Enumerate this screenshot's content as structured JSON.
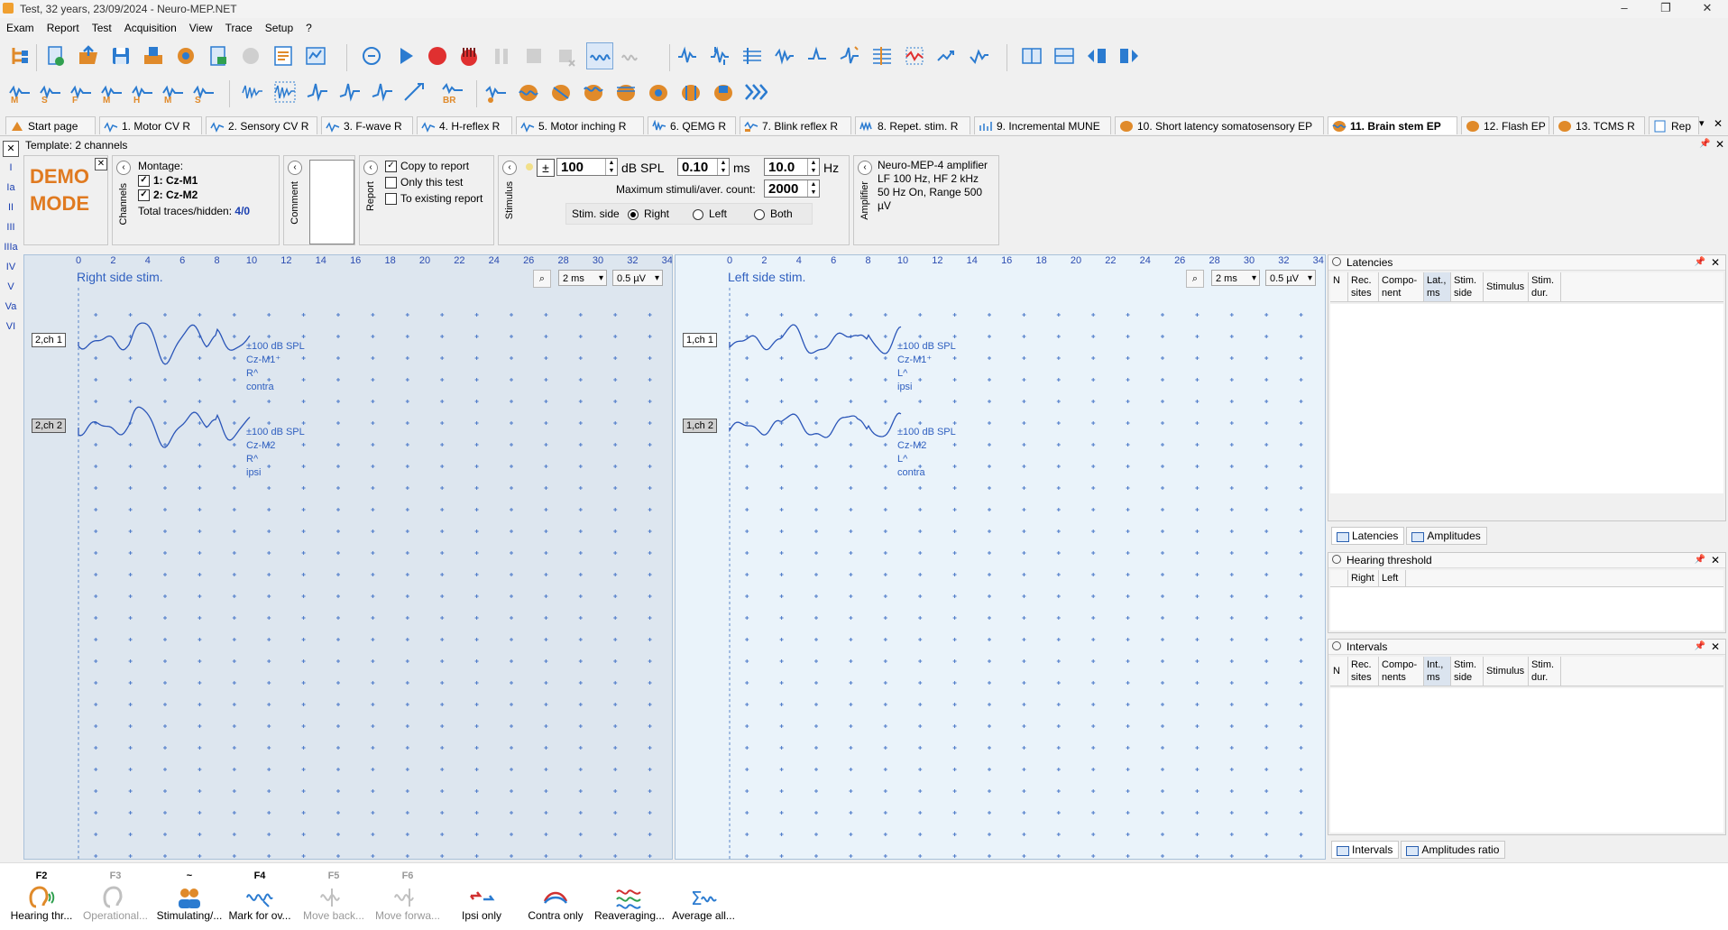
{
  "window": {
    "title": "Test, 32 years, 23/09/2024 - Neuro-MEP.NET",
    "min": "–",
    "max": "❐",
    "close": "✕"
  },
  "menu": [
    "Exam",
    "Report",
    "Test",
    "Acquisition",
    "View",
    "Trace",
    "Setup",
    "?"
  ],
  "tabs": [
    {
      "label": "Start page",
      "active": false
    },
    {
      "label": "1. Motor CV R",
      "active": false
    },
    {
      "label": "2. Sensory CV R",
      "active": false
    },
    {
      "label": "3. F-wave R",
      "active": false
    },
    {
      "label": "4. H-reflex R",
      "active": false
    },
    {
      "label": "5. Motor inching R",
      "active": false
    },
    {
      "label": "6. QEMG R",
      "active": false
    },
    {
      "label": "7. Blink reflex R",
      "active": false
    },
    {
      "label": "8. Repet. stim. R",
      "active": false
    },
    {
      "label": "9. Incremental MUNE",
      "active": false
    },
    {
      "label": "10. Short latency somatosensory EP",
      "active": false
    },
    {
      "label": "11. Brain stem EP",
      "active": true
    },
    {
      "label": "12. Flash EP",
      "active": false
    },
    {
      "label": "13. TCMS R",
      "active": false
    },
    {
      "label": "Rep",
      "active": false
    }
  ],
  "rail": [
    "I",
    "Ia",
    "II",
    "III",
    "IIIa",
    "IV",
    "V",
    "Va",
    "VI"
  ],
  "template": {
    "title": "Template: 2 channels"
  },
  "demo": {
    "line1": "DEMO",
    "line2": "MODE"
  },
  "channels": {
    "vlabel": "Channels",
    "montage_label": "Montage:",
    "items": [
      "1: Cz-M1",
      "2: Cz-M2"
    ],
    "total_label": "Total traces/hidden:",
    "total_value": "4/0"
  },
  "comment": {
    "vlabel": "Comment"
  },
  "report": {
    "vlabel": "Report",
    "options": [
      {
        "label": "Copy to report",
        "checked": true
      },
      {
        "label": "Only this test",
        "checked": false
      },
      {
        "label": "To existing report",
        "checked": false
      }
    ]
  },
  "stimulus": {
    "vlabel": "Stimulus",
    "intensity": "100",
    "intensity_unit": "dB SPL",
    "duration": "0.10",
    "duration_unit": "ms",
    "rate": "10.0",
    "rate_unit": "Hz",
    "max_label": "Maximum stimuli/aver. count:",
    "max_value": "2000",
    "side_label": "Stim. side",
    "sides": [
      {
        "label": "Right",
        "selected": true
      },
      {
        "label": "Left",
        "selected": false
      },
      {
        "label": "Both",
        "selected": false
      }
    ]
  },
  "amplifier": {
    "vlabel": "Amplifier",
    "line1": "Neuro-MEP-4 amplifier",
    "line2": "LF  100 Hz, HF  2 kHz",
    "line3": "50 Hz  On, Range 500 µV"
  },
  "axis_ticks": [
    "0",
    "2",
    "4",
    "6",
    "8",
    "10",
    "12",
    "14",
    "16",
    "18",
    "20",
    "22",
    "24",
    "26",
    "28",
    "30",
    "32",
    "34"
  ],
  "panels": [
    {
      "title": "Right side stim.",
      "timebase": "2 ms",
      "sensitivity": "0.5 µV",
      "traces": [
        {
          "label": "2,ch 1",
          "selected": false,
          "annotation": "±100 dB SPL\nCz-M1⁺\nR^\ncontra"
        },
        {
          "label": "2,ch 2",
          "selected": true,
          "annotation": "±100 dB SPL\nCz-M2\nR^\nipsi"
        }
      ]
    },
    {
      "title": "Left side stim.",
      "timebase": "2 ms",
      "sensitivity": "0.5 µV",
      "traces": [
        {
          "label": "1,ch 1",
          "selected": false,
          "annotation": "±100 dB SPL\nCz-M1⁺\nL^\nipsi"
        },
        {
          "label": "1,ch 2",
          "selected": true,
          "annotation": "±100 dB SPL\nCz-M2\nL^\ncontra"
        }
      ]
    }
  ],
  "latencies": {
    "title": "Latencies",
    "columns": [
      "N",
      "Rec. sites",
      "Compo- nent",
      "Lat., ms",
      "Stim. side",
      "Stimulus",
      "Stim. dur."
    ],
    "tabs": [
      "Latencies",
      "Amplitudes"
    ]
  },
  "hearing": {
    "title": "Hearing threshold",
    "columns": [
      "Right",
      "Left"
    ]
  },
  "intervals": {
    "title": "Intervals",
    "columns": [
      "N",
      "Rec. sites",
      "Compo- nents",
      "Int., ms",
      "Stim. side",
      "Stimulus",
      "Stim. dur."
    ],
    "tabs": [
      "Intervals",
      "Amplitudes ratio"
    ]
  },
  "bottom_actions": [
    {
      "key": "F2",
      "label": "Hearing thr...",
      "enabled": true,
      "color": "#e08a2a"
    },
    {
      "key": "F3",
      "label": "Operational...",
      "enabled": false,
      "color": "#b0b0b0"
    },
    {
      "key": "~",
      "label": "Stimulating/...",
      "enabled": true,
      "color": "#3070c0"
    },
    {
      "key": "F4",
      "label": "Mark for ov...",
      "enabled": true,
      "color": "#2b7bd0"
    },
    {
      "key": "F5",
      "label": "Move back...",
      "enabled": false,
      "color": "#b0b0b0"
    },
    {
      "key": "F6",
      "label": "Move forwa...",
      "enabled": false,
      "color": "#b0b0b0"
    },
    {
      "key": "",
      "label": "Ipsi only",
      "enabled": true,
      "color": "#d03030"
    },
    {
      "key": "",
      "label": "Contra only",
      "enabled": true,
      "color": "#3060c0"
    },
    {
      "key": "",
      "label": "Reaveraging...",
      "enabled": true,
      "color": "#30a050"
    },
    {
      "key": "",
      "label": "Average all...",
      "enabled": true,
      "color": "#2b7bd0"
    }
  ]
}
